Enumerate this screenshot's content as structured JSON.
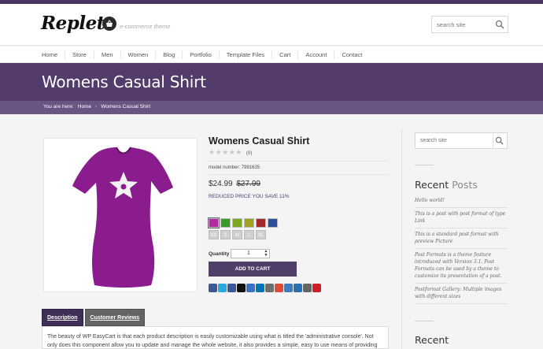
{
  "header": {
    "logo": "Replete",
    "tagline": "e-commerce theme",
    "search_placeholder": "search site"
  },
  "nav": [
    "Home",
    "Store",
    "Men",
    "Women",
    "Blog",
    "Portfolio",
    "Template Files",
    "Cart",
    "Account",
    "Contact"
  ],
  "banner": {
    "title": "Womens Casual Shirt"
  },
  "breadcrumb": {
    "prefix": "You are here:",
    "home": "Home",
    "current": "Womens Casual Shirt"
  },
  "product": {
    "title": "Womens Casual Shirt",
    "stars": "★★★★★",
    "rating_count": "(0)",
    "model": "model number: 7991635",
    "price": "$24.99",
    "old_price": "$27.99",
    "savings": "REDUCED PRICE YOU SAVE 11%",
    "swatch_colors": [
      "#b02ba0",
      "#3c9a2a",
      "#7da823",
      "#a3a123",
      "#a52a2a",
      "#2d4f9a"
    ],
    "sizes": [
      "XS",
      "S",
      "M",
      "L",
      "XL"
    ],
    "quantity_label": "Quantity",
    "quantity_value": "1",
    "add_to_cart": "ADD TO CART",
    "share_colors": [
      "#3b5998",
      "#2aa9e0",
      "#3b5998",
      "#111111",
      "#3a70c6",
      "#0077b5",
      "#6e6e6e",
      "#dd4b39",
      "#3b7bbf",
      "#2a6fb0",
      "#666666",
      "#cb2027"
    ]
  },
  "tabs": {
    "description": "Description",
    "reviews": "Customer Reviews",
    "content": "The beauty of WP EasyCart is that each product description is easily customizable using what is titled the 'administrative console'. Not only does this component allow you to update and manage the whole website, it also provides a simple, easy to use means of providing unique"
  },
  "sidebar": {
    "search_placeholder": "search site",
    "recent_word": "Recent",
    "posts_word": "Posts",
    "posts": [
      "Hello world!",
      "This is a post with post format of type Link",
      "This is a standard post format with preview Picture",
      "Post Formats is a theme feature introduced with Version 3.1. Post Formats can be used by a theme to customize its presentation of a post.",
      "Postformat Gallery: Multiple images with different sizes"
    ],
    "recent_title_2": "Recent"
  }
}
